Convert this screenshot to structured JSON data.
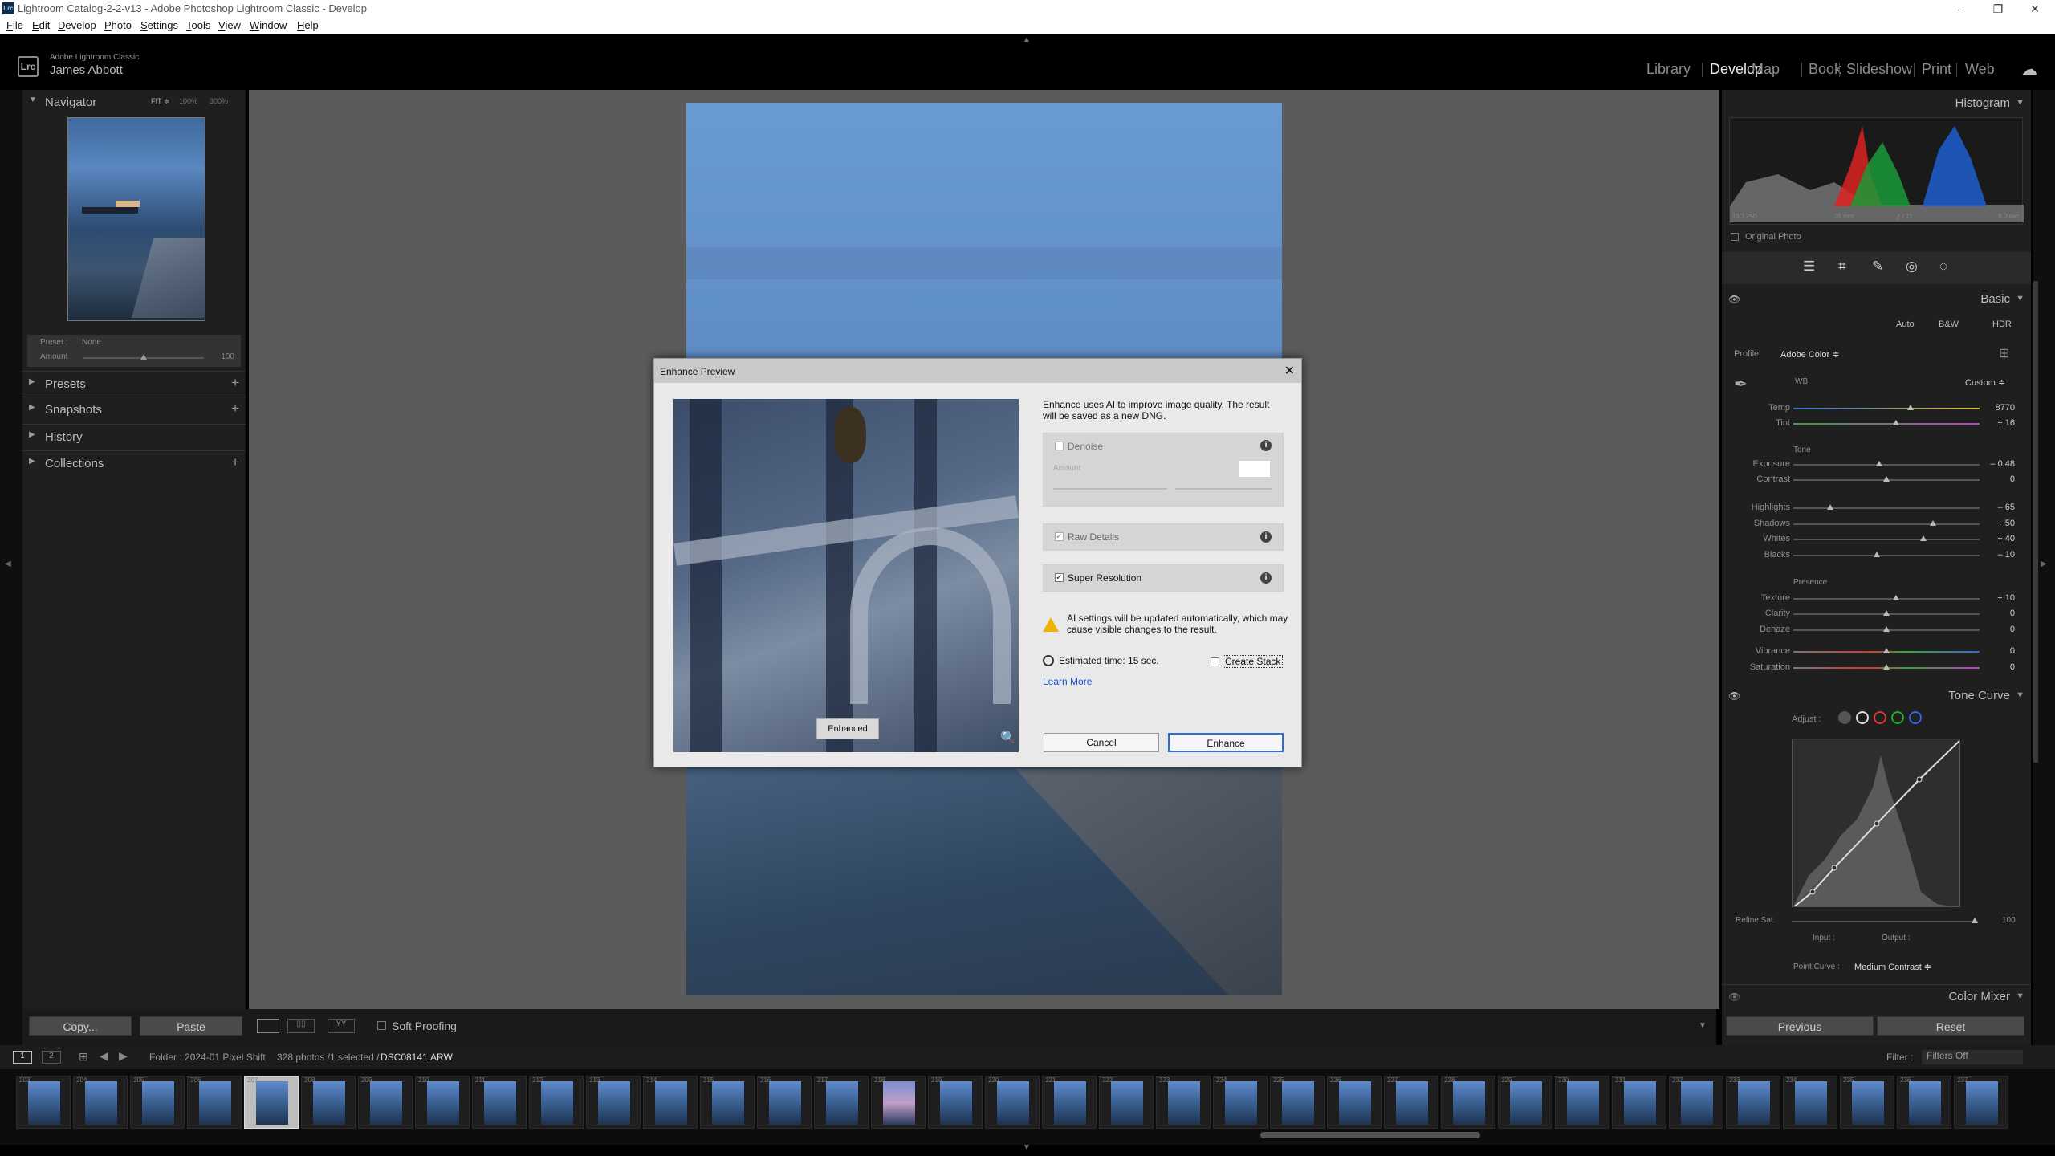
{
  "window": {
    "title": "Lightroom Catalog-2-2-v13 - Adobe Photoshop Lightroom Classic - Develop",
    "app_icon": "Lrc"
  },
  "menu": [
    "File",
    "Edit",
    "Develop",
    "Photo",
    "Settings",
    "Tools",
    "View",
    "Window",
    "Help"
  ],
  "identity": {
    "app": "Adobe Lightroom Classic",
    "user": "James Abbott"
  },
  "modules": [
    "Library",
    "Develop",
    "Map",
    "Book",
    "Slideshow",
    "Print",
    "Web"
  ],
  "active_module": "Develop",
  "left": {
    "navigator": {
      "label": "Navigator",
      "fit": "FIT ≑",
      "z1": "100%",
      "z2": "300%"
    },
    "preset": {
      "label": "Preset :",
      "value": "None",
      "amount_label": "Amount",
      "amount_value": "100"
    },
    "sections": [
      "Presets",
      "Snapshots",
      "History",
      "Collections"
    ]
  },
  "dialog": {
    "title": "Enhance Preview",
    "preview_button": "Enhanced",
    "description": "Enhance uses AI to improve image quality. The result will be saved as a new DNG.",
    "denoise": {
      "label": "Denoise",
      "amount_label": "Amount",
      "checked": false
    },
    "raw_details": {
      "label": "Raw Details",
      "checked": true
    },
    "super_resolution": {
      "label": "Super Resolution",
      "checked": true
    },
    "warning": "AI settings will be updated automatically, which may cause visible changes to the result.",
    "estimated": "Estimated time: 15 sec.",
    "create_stack": "Create Stack",
    "learn_more": "Learn More",
    "cancel": "Cancel",
    "enhance": "Enhance"
  },
  "right": {
    "histogram": {
      "label": "Histogram",
      "iso": "ISO 250",
      "focal": "35 mm",
      "aperture": "ƒ / 11",
      "shutter": "8.0 sec",
      "original": "Original Photo"
    },
    "basic": {
      "label": "Basic",
      "auto": "Auto",
      "bw": "B&W",
      "hdr": "HDR",
      "profile_label": "Profile",
      "profile_value": "Adobe Color ≑",
      "wb_label": "WB",
      "wb_value": "Custom ≑",
      "tone_label": "Tone",
      "presence_label": "Presence",
      "sliders": [
        {
          "label": "Temp",
          "value": "8770",
          "pos": 0.63
        },
        {
          "label": "Tint",
          "value": "+ 16",
          "pos": 0.55
        },
        {
          "label": "Exposure",
          "value": "– 0.48",
          "pos": 0.46
        },
        {
          "label": "Contrast",
          "value": "0",
          "pos": 0.5
        },
        {
          "label": "Highlights",
          "value": "– 65",
          "pos": 0.2
        },
        {
          "label": "Shadows",
          "value": "+ 50",
          "pos": 0.75
        },
        {
          "label": "Whites",
          "value": "+ 40",
          "pos": 0.7
        },
        {
          "label": "Blacks",
          "value": "– 10",
          "pos": 0.45
        },
        {
          "label": "Texture",
          "value": "+ 10",
          "pos": 0.55
        },
        {
          "label": "Clarity",
          "value": "0",
          "pos": 0.5
        },
        {
          "label": "Dehaze",
          "value": "0",
          "pos": 0.5
        },
        {
          "label": "Vibrance",
          "value": "0",
          "pos": 0.5
        },
        {
          "label": "Saturation",
          "value": "0",
          "pos": 0.5
        }
      ]
    },
    "tone_curve": {
      "label": "Tone Curve",
      "adjust": "Adjust :",
      "refine": "Refine Sat.",
      "refine_value": "100",
      "input": "Input :",
      "output": "Output :",
      "point_curve_label": "Point Curve :",
      "point_curve_value": "Medium Contrast ≑"
    },
    "color_mixer": "Color Mixer",
    "previous": "Previous",
    "reset": "Reset"
  },
  "bottom": {
    "copy": "Copy...",
    "paste": "Paste",
    "soft_proofing": "Soft Proofing",
    "folder": "Folder : 2024-01 Pixel Shift",
    "count": "328 photos /1 selected /",
    "file": "DSC08141.ARW",
    "filter_label": "Filter :",
    "filter_value": "Filters Off",
    "screens": [
      "1",
      "2"
    ]
  },
  "filmstrip_numbers": [
    "203",
    "204",
    "205",
    "206",
    "207",
    "208",
    "209",
    "210",
    "211",
    "212",
    "213",
    "214",
    "215",
    "216",
    "217",
    "218",
    "219",
    "220",
    "221",
    "222",
    "223",
    "224",
    "225",
    "226",
    "227",
    "228",
    "229",
    "230",
    "231",
    "232",
    "233",
    "234",
    "235",
    "236",
    "237"
  ]
}
